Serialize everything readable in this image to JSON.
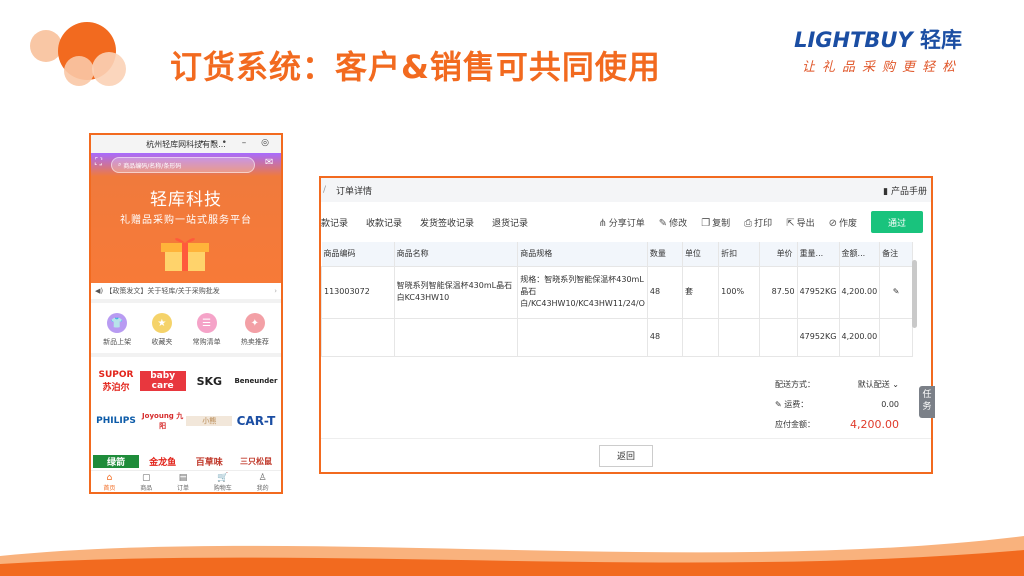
{
  "slide": {
    "title": "订货系统：客户&销售可共同使用",
    "brand_logo_latin": "LIGHTBUY",
    "brand_logo_cn": "轻库",
    "brand_slogan": "让礼品采购更轻松"
  },
  "colors": {
    "accent": "#f26a1f",
    "brand_blue": "#1b4ea3",
    "pass_green": "#19c37d",
    "total_red": "#e03b2b"
  },
  "phone": {
    "window_title": "杭州轻库网科技有限...",
    "search_placeholder": "商品编码/名称/条形码",
    "company": "轻库科技",
    "subtitle": "礼赠品采购一站式服务平台",
    "notice": "【政策发文】关于轻库/关于采购批发",
    "icons": [
      {
        "label": "新品上架",
        "icon": "tshirt-icon"
      },
      {
        "label": "收藏夹",
        "icon": "star-icon"
      },
      {
        "label": "常购清单",
        "icon": "list-icon"
      },
      {
        "label": "热卖推荐",
        "icon": "fire-icon"
      }
    ],
    "brands_row1": [
      "SUPOR 苏泊尔",
      "baby care",
      "SKG",
      "Beneunder"
    ],
    "brands_row2": [
      "PHILIPS",
      "Joyoung 九阳",
      "小熊",
      "CAR-T"
    ],
    "brands_row3": [
      "绿箭",
      "金龙鱼",
      "百草味",
      "三只松鼠"
    ],
    "tabs": [
      "首页",
      "商品",
      "订单",
      "购物车",
      "我的"
    ]
  },
  "order": {
    "breadcrumb": "订单详情",
    "manual": "产品手册",
    "tabs": [
      "款记录",
      "收款记录",
      "发货签收记录",
      "退货记录"
    ],
    "actions": [
      "分享订单",
      "修改",
      "复制",
      "打印",
      "导出",
      "作废"
    ],
    "pass_button": "通过",
    "columns": [
      "商品编码",
      "商品名称",
      "商品规格",
      "数量",
      "单位",
      "折扣",
      "单价",
      "重量...",
      "金额...",
      "备注"
    ],
    "rows": [
      {
        "code": "113003072",
        "name": "智晓系列智能保温杯430mL晶石白KC43HW10",
        "spec": "规格：智晓系列智能保温杯430mL晶石白/KC43HW10/KC43HW11/24/O",
        "qty": "48",
        "unit": "套",
        "discount": "100%",
        "price": "87.50",
        "weight": "47952KG",
        "amount": "4,200.00"
      }
    ],
    "total_row": {
      "qty": "48",
      "weight": "47952KG",
      "amount": "4,200.00"
    },
    "delivery_label": "配送方式：",
    "delivery_value": "默认配送",
    "freight_label": "运费：",
    "freight_value": "0.00",
    "payable_label": "应付金额：",
    "payable_value": "4,200.00",
    "back_button": "返回",
    "task_tab": "任务"
  }
}
